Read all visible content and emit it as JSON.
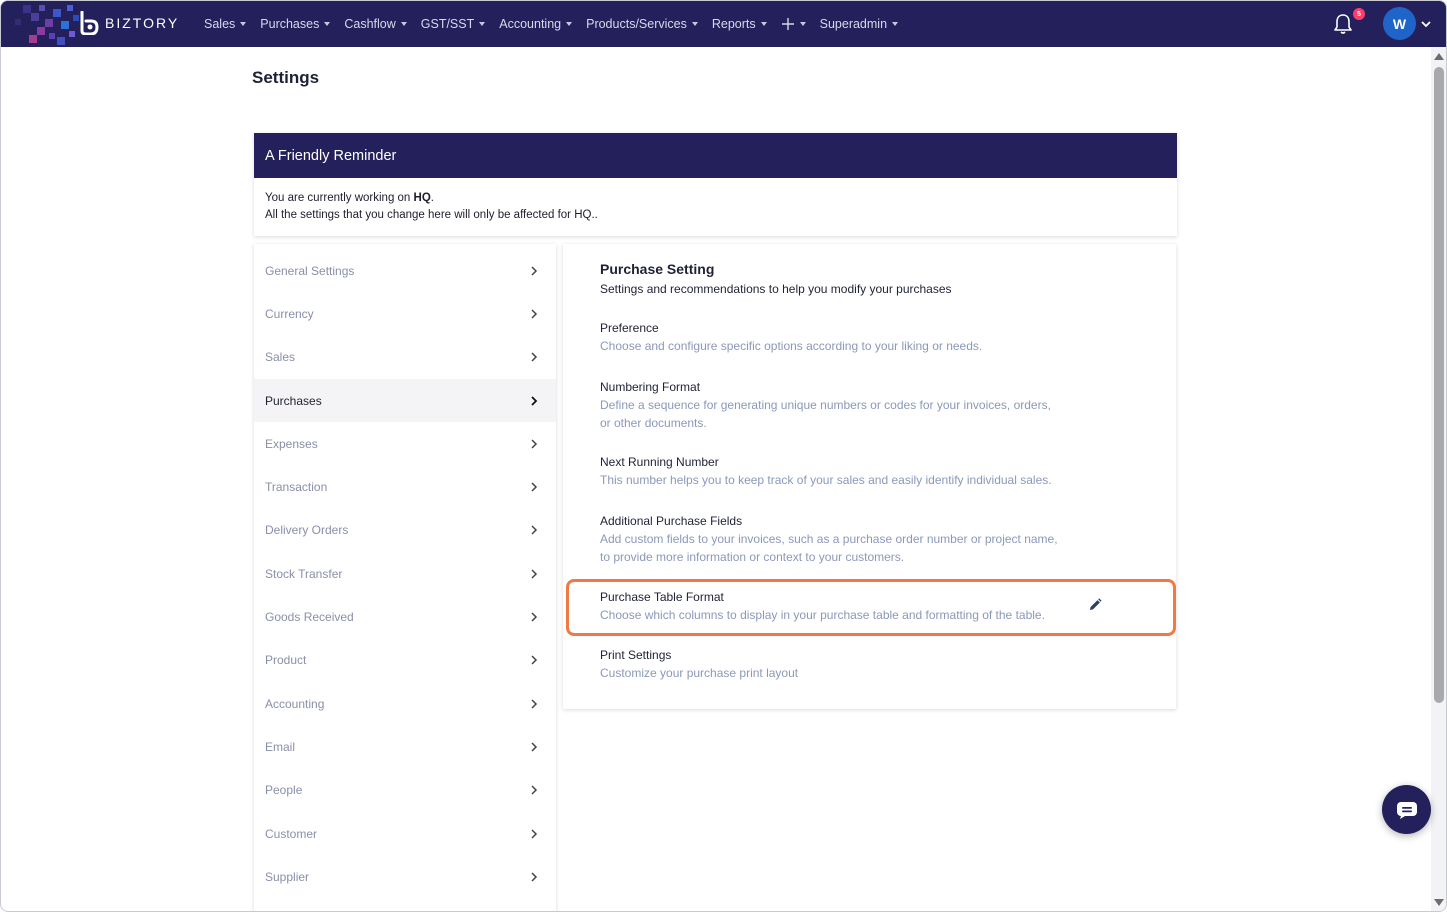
{
  "brand": {
    "name": "BIZTORY"
  },
  "nav": {
    "items": [
      {
        "label": "Sales"
      },
      {
        "label": "Purchases"
      },
      {
        "label": "Cashflow"
      },
      {
        "label": "GST/SST"
      },
      {
        "label": "Accounting"
      },
      {
        "label": "Products/Services"
      },
      {
        "label": "Reports"
      }
    ],
    "quick_add_icon": "plus-icon",
    "user_menu": "Superadmin",
    "notification_count": "5",
    "avatar_initial": "W"
  },
  "page": {
    "title": "Settings"
  },
  "reminder": {
    "title": "A Friendly Reminder",
    "line1_prefix": "You are currently working on ",
    "line1_branch": "HQ",
    "line1_suffix": ".",
    "line2": "All the settings that you change here will only be affected for HQ.."
  },
  "sidebar": {
    "items": [
      {
        "label": "General Settings"
      },
      {
        "label": "Currency"
      },
      {
        "label": "Sales"
      },
      {
        "label": "Purchases",
        "active": true
      },
      {
        "label": "Expenses"
      },
      {
        "label": "Transaction"
      },
      {
        "label": "Delivery Orders"
      },
      {
        "label": "Stock Transfer"
      },
      {
        "label": "Goods Received"
      },
      {
        "label": "Product"
      },
      {
        "label": "Accounting"
      },
      {
        "label": "Email"
      },
      {
        "label": "People"
      },
      {
        "label": "Customer"
      },
      {
        "label": "Supplier"
      }
    ]
  },
  "content": {
    "title": "Purchase Setting",
    "subtitle": "Settings and recommendations to help you modify your purchases",
    "options": [
      {
        "title": "Preference",
        "desc": "Choose and configure specific options according to your liking or needs."
      },
      {
        "title": "Numbering Format",
        "desc": "Define a sequence for generating unique numbers or codes for your invoices, orders, or other documents."
      },
      {
        "title": "Next Running Number",
        "desc": "This number helps you to keep track of your sales and easily identify individual sales."
      },
      {
        "title": "Additional Purchase Fields",
        "desc": "Add custom fields to your invoices, such as a purchase order number or project name, to provide more information or context to your customers."
      },
      {
        "title": "Purchase Table Format",
        "desc": "Choose which columns to display in your purchase table and formatting of the table.",
        "highlighted": true
      },
      {
        "title": "Print Settings",
        "desc": "Customize your purchase print layout"
      }
    ]
  },
  "colors": {
    "navbar": "#24205c",
    "highlight": "#ef7b44",
    "accent": "#1f64c8",
    "desc_text": "#8b98b8"
  }
}
